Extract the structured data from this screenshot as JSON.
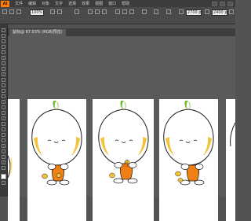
{
  "app": {
    "logo_text": "Ai"
  },
  "menubar": {
    "items": [
      "文件",
      "编辑",
      "对象",
      "文字",
      "选择",
      "效果",
      "视图",
      "窗口",
      "帮助"
    ]
  },
  "control_bar": {
    "zoom_value": "100%",
    "field_a": "2700 px",
    "field_b": "2400 px"
  },
  "document_tab": {
    "label": "鼠标@ 67.03% (RGB/预览)"
  },
  "colors": {
    "accent": "#ff7c00",
    "orange_shorts": "#f07f16",
    "yellow_cheek": "#f3c43b",
    "leaf_green": "#6fba2f"
  }
}
